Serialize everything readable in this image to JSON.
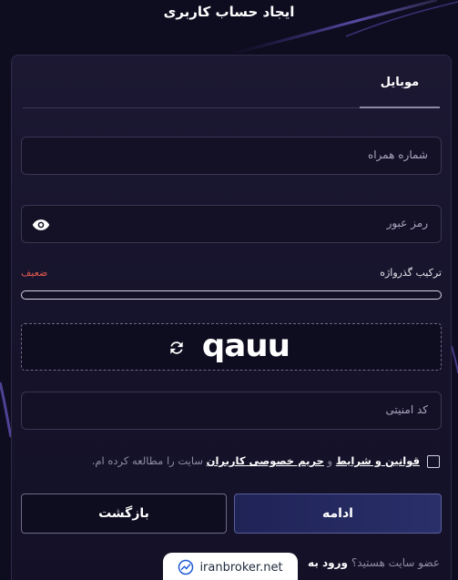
{
  "header": {
    "title": "ایجاد حساب کاربری"
  },
  "tabs": [
    {
      "label": "موبایل",
      "active": true
    }
  ],
  "form": {
    "phone": {
      "placeholder": "شماره همراه",
      "value": ""
    },
    "password": {
      "placeholder": "رمز عبور",
      "value": ""
    },
    "strength": {
      "label": "ترکیب گذرواژه",
      "value": "ضعیف",
      "level": 0
    },
    "captcha": {
      "code": "qauu"
    },
    "security_code": {
      "placeholder": "کد امنیتی",
      "value": ""
    },
    "terms": {
      "checked": false,
      "link_terms": "قوانین و شرایط",
      "and": "و",
      "link_privacy": "حریم خصوصی کاربران",
      "suffix": "سایت را مطالعه کرده ام."
    },
    "continue_label": "ادامه",
    "back_label": "بازگشت"
  },
  "footer": {
    "member_question": "عضو سایت هستید؟",
    "login_label": "ورود به"
  },
  "watermark": {
    "text": "iranbroker.net"
  },
  "colors": {
    "background": "#0e0c1f",
    "card": "#1c1833",
    "weak": "#e35b4f",
    "primary_button": "#2a2f6a"
  }
}
